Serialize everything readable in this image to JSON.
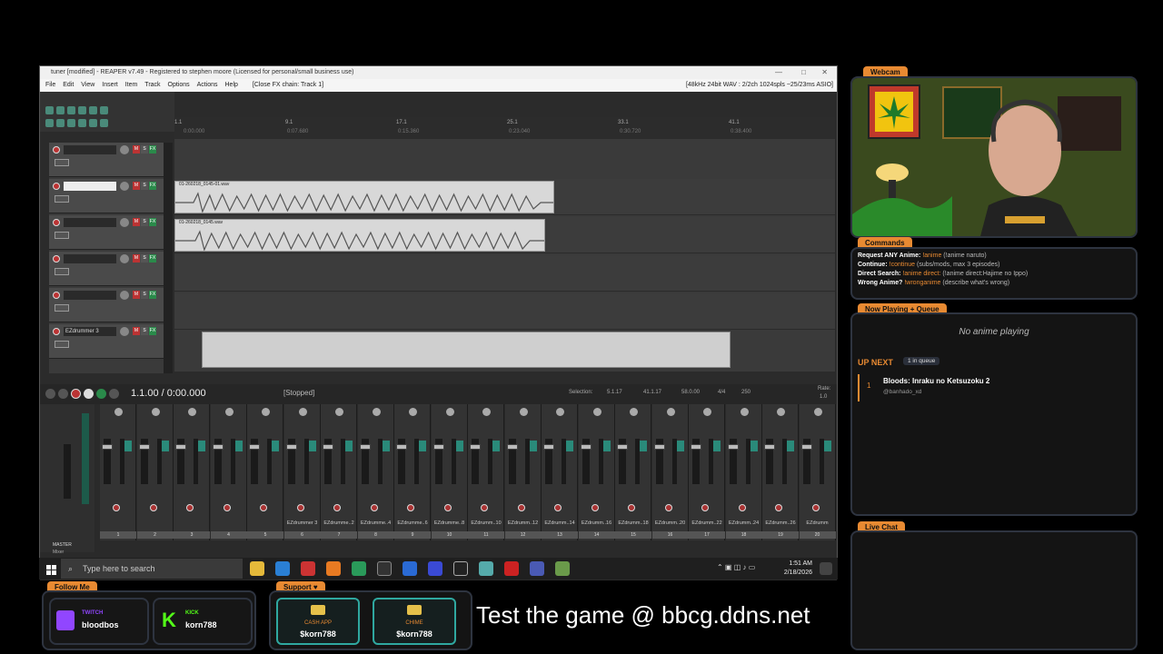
{
  "app": {
    "title": "tuner [modified] - REAPER v7.49 - Registered to stephen moore (Licensed for personal/small business use)",
    "menu": [
      "File",
      "Edit",
      "View",
      "Insert",
      "Item",
      "Track",
      "Options",
      "Actions",
      "Help",
      "[Close FX chain: Track 1]"
    ],
    "audio_info": "[48kHz 24bit WAV : 2/2ch 1024spls ~25/23ms ASIO]",
    "ruler": [
      "1.1",
      "9.1",
      "17.1",
      "25.1",
      "33.1",
      "41.1"
    ],
    "ruler_times": [
      "0:00.000",
      "0:07.680",
      "0:15.360",
      "0:23.040",
      "0:30.720",
      "0:38.400"
    ],
    "tracks": [
      {
        "name": ""
      },
      {
        "name": ""
      },
      {
        "name": ""
      },
      {
        "name": ""
      },
      {
        "name": ""
      },
      {
        "name": "EZdrummer 3"
      }
    ],
    "items": [
      {
        "label": "01-260218_0145-01.wav"
      },
      {
        "label": "01-260218_0145.wav"
      }
    ],
    "track_info": "Track 2 (IO) none"
  },
  "transport": {
    "time": "1.1.00 / 0:00.000",
    "status": "[Stopped]",
    "selection_label": "Selection:",
    "sel_start": "5.1.17",
    "sel_end": "41.1.17",
    "sel_len": "58.0.00",
    "timesig": "4/4",
    "bpm": "250",
    "rate_label": "Rate:",
    "rate": "1.0"
  },
  "mixer": {
    "master_label": "MASTER",
    "tab_label": "Mixer",
    "channels": [
      {
        "name": "",
        "num": "1"
      },
      {
        "name": "",
        "num": "2"
      },
      {
        "name": "",
        "num": "3"
      },
      {
        "name": "",
        "num": "4"
      },
      {
        "name": "",
        "num": "5"
      },
      {
        "name": "EZdrummer 3",
        "num": "6"
      },
      {
        "name": "EZdrumme..2",
        "num": "7"
      },
      {
        "name": "EZdrumme..4",
        "num": "8"
      },
      {
        "name": "EZdrumme..6",
        "num": "9"
      },
      {
        "name": "EZdrumme..8",
        "num": "10"
      },
      {
        "name": "EZdrumm..10",
        "num": "11"
      },
      {
        "name": "EZdrumm..12",
        "num": "12"
      },
      {
        "name": "EZdrumm..14",
        "num": "13"
      },
      {
        "name": "EZdrumm..16",
        "num": "14"
      },
      {
        "name": "EZdrumm..18",
        "num": "15"
      },
      {
        "name": "EZdrumm..20",
        "num": "16"
      },
      {
        "name": "EZdrumm..22",
        "num": "17"
      },
      {
        "name": "EZdrumm..24",
        "num": "18"
      },
      {
        "name": "EZdrumm..26",
        "num": "19"
      },
      {
        "name": "EZdrumm",
        "num": "20"
      }
    ]
  },
  "taskbar": {
    "search_placeholder": "Type here to search",
    "time": "1:51 AM",
    "date": "2/18/2026"
  },
  "overlay": {
    "webcam_tab": "Webcam",
    "commands_tab": "Commands",
    "commands": [
      {
        "label": "Request ANY Anime:",
        "cmd": "!anime",
        "desc": "(!anime naruto)"
      },
      {
        "label": "Continue:",
        "cmd": "!continue",
        "desc": "(subs/mods, max 3 episodes)"
      },
      {
        "label": "Direct Search:",
        "cmd": "!anime direct:",
        "desc": "(!anime direct:Hajime no Ippo)"
      },
      {
        "label": "Wrong Anime?",
        "cmd": "!wronganime",
        "desc": "(describe what's wrong)"
      }
    ],
    "now_playing_tab": "Now Playing + Queue",
    "no_anime": "No anime playing",
    "up_next": "UP NEXT",
    "queue_count": "1 in queue",
    "queue": [
      {
        "num": "1",
        "title": "Bloods: Inraku no Ketsuzoku 2",
        "user": "@banhado_xd"
      }
    ],
    "live_chat_tab": "Live Chat",
    "follow_tab": "Follow Me",
    "twitch_label": "TWITCH",
    "twitch_user": "bloodbos",
    "kick_label": "KICK",
    "kick_user": "korn788",
    "support_tab": "Support",
    "cashapp_label": "CASH APP",
    "cashapp_user": "$korn788",
    "chime_label": "CHIME",
    "chime_user": "$korn788",
    "banner": "Test the game @ bbcg.ddns.net",
    "colors": {
      "accent": "#e88a32",
      "twitch": "#9146ff",
      "kick": "#53fc18",
      "teal": "#2fa8a0"
    }
  }
}
